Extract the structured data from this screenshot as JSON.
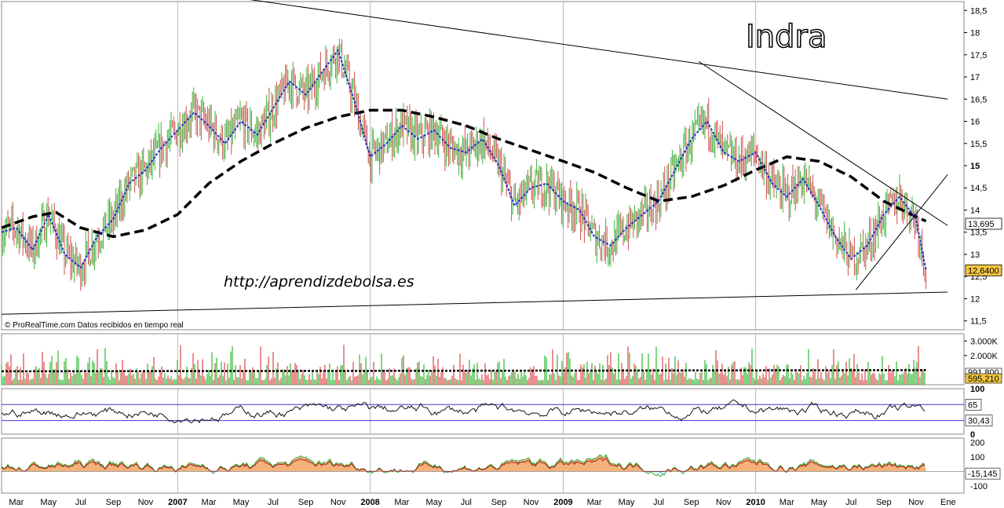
{
  "chart_data": [
    {
      "type": "line",
      "title": "Indra",
      "watermark": "http://aprendizdebolsa.es",
      "credit": "© ProRealTime.com  Datos recibidos en tiempo real",
      "y_axis": {
        "ticks": [
          "18,5",
          "18",
          "17,5",
          "17",
          "16,5",
          "16",
          "15,5",
          "15",
          "14,5",
          "14",
          "13,5",
          "13",
          "12,5",
          "12",
          "11,5"
        ],
        "ylim": [
          11.3,
          18.7
        ]
      },
      "price_boxes": {
        "sma_short": "13,695",
        "last": "12,6400"
      },
      "series": [
        {
          "values": [
            [
              "2006-02-01",
              13.5
            ],
            [
              "2006-03-01",
              13.6
            ],
            [
              "2006-04-01",
              13.1
            ],
            [
              "2006-05-01",
              13.9
            ],
            [
              "2006-06-01",
              13.0
            ],
            [
              "2006-07-01",
              12.7
            ],
            [
              "2006-08-01",
              13.4
            ],
            [
              "2006-09-01",
              13.8
            ],
            [
              "2006-10-01",
              14.6
            ],
            [
              "2006-11-01",
              14.9
            ],
            [
              "2006-12-01",
              15.4
            ],
            [
              "2007-01-01",
              15.8
            ],
            [
              "2007-02-01",
              16.2
            ],
            [
              "2007-03-01",
              15.9
            ],
            [
              "2007-04-01",
              15.5
            ],
            [
              "2007-05-01",
              16.0
            ],
            [
              "2007-06-01",
              15.7
            ],
            [
              "2007-07-01",
              16.3
            ],
            [
              "2007-08-01",
              16.9
            ],
            [
              "2007-09-01",
              16.6
            ],
            [
              "2007-10-01",
              17.1
            ],
            [
              "2007-11-01",
              17.6
            ],
            [
              "2007-12-01",
              16.5
            ],
            [
              "2008-01-01",
              15.2
            ],
            [
              "2008-02-01",
              15.5
            ],
            [
              "2008-03-01",
              15.9
            ],
            [
              "2008-04-01",
              15.6
            ],
            [
              "2008-05-01",
              15.8
            ],
            [
              "2008-06-01",
              15.4
            ],
            [
              "2008-07-01",
              15.3
            ],
            [
              "2008-08-01",
              15.6
            ],
            [
              "2008-09-01",
              15.0
            ],
            [
              "2008-10-01",
              14.1
            ],
            [
              "2008-11-01",
              14.5
            ],
            [
              "2008-12-01",
              14.6
            ],
            [
              "2009-01-01",
              14.2
            ],
            [
              "2009-02-01",
              14.0
            ],
            [
              "2009-03-01",
              13.4
            ],
            [
              "2009-04-01",
              13.2
            ],
            [
              "2009-05-01",
              13.6
            ],
            [
              "2009-06-01",
              13.9
            ],
            [
              "2009-07-01",
              14.2
            ],
            [
              "2009-08-01",
              14.9
            ],
            [
              "2009-09-01",
              15.6
            ],
            [
              "2009-10-01",
              16.0
            ],
            [
              "2009-11-01",
              15.3
            ],
            [
              "2009-12-01",
              15.1
            ],
            [
              "2010-01-01",
              15.3
            ],
            [
              "2010-02-01",
              14.6
            ],
            [
              "2010-03-01",
              14.3
            ],
            [
              "2010-04-01",
              14.7
            ],
            [
              "2010-05-01",
              14.1
            ],
            [
              "2010-06-01",
              13.4
            ],
            [
              "2010-07-01",
              12.9
            ],
            [
              "2010-08-01",
              13.2
            ],
            [
              "2010-09-01",
              13.9
            ],
            [
              "2010-10-01",
              14.3
            ],
            [
              "2010-11-01",
              13.8
            ],
            [
              "2010-11-20",
              12.64
            ]
          ]
        },
        {
          "values": [
            [
              "2006-02-01",
              13.6
            ],
            [
              "2006-04-01",
              13.85
            ],
            [
              "2006-05-15",
              13.95
            ],
            [
              "2006-07-01",
              13.6
            ],
            [
              "2006-09-01",
              13.4
            ],
            [
              "2006-11-01",
              13.55
            ],
            [
              "2007-01-01",
              13.9
            ],
            [
              "2007-03-01",
              14.6
            ],
            [
              "2007-05-01",
              15.1
            ],
            [
              "2007-07-01",
              15.5
            ],
            [
              "2007-09-01",
              15.85
            ],
            [
              "2007-11-01",
              16.1
            ],
            [
              "2008-01-01",
              16.25
            ],
            [
              "2008-03-01",
              16.25
            ],
            [
              "2008-05-01",
              16.1
            ],
            [
              "2008-07-01",
              15.9
            ],
            [
              "2008-09-01",
              15.6
            ],
            [
              "2008-11-01",
              15.35
            ],
            [
              "2009-01-01",
              15.1
            ],
            [
              "2009-03-01",
              14.85
            ],
            [
              "2009-05-01",
              14.5
            ],
            [
              "2009-07-01",
              14.2
            ],
            [
              "2009-09-01",
              14.3
            ],
            [
              "2009-11-01",
              14.55
            ],
            [
              "2010-01-01",
              14.9
            ],
            [
              "2010-03-01",
              15.2
            ],
            [
              "2010-05-01",
              15.1
            ],
            [
              "2010-07-01",
              14.75
            ],
            [
              "2010-09-01",
              14.2
            ],
            [
              "2010-11-01",
              13.85
            ],
            [
              "2010-11-20",
              13.75
            ]
          ]
        }
      ],
      "trendlines": [
        {
          "from": [
            "2006-02-01",
            11.65
          ],
          "to": [
            "2010-12-31",
            12.15
          ]
        },
        {
          "from": [
            "2007-04-15",
            18.8
          ],
          "to": [
            "2010-12-31",
            16.5
          ]
        },
        {
          "from": [
            "2009-09-15",
            17.35
          ],
          "to": [
            "2010-12-31",
            13.65
          ]
        },
        {
          "from": [
            "2010-07-10",
            12.2
          ],
          "to": [
            "2010-12-31",
            14.8
          ]
        }
      ]
    },
    {
      "type": "bar",
      "y_axis": {
        "ticks": [
          "3.000K",
          "2.000K"
        ]
      },
      "value_boxes": {
        "average": "991,800",
        "last": "595,210"
      }
    },
    {
      "type": "line",
      "y_axis": {
        "ticks": [
          "100",
          "0"
        ],
        "ylim": [
          0,
          100
        ]
      },
      "levels": [
        65,
        30
      ],
      "value_boxes": {
        "level": "65",
        "last": "30,43"
      }
    },
    {
      "type": "area",
      "y_axis": {
        "ticks": [
          "200",
          "100",
          "-100"
        ],
        "ylim": [
          -150,
          230
        ]
      },
      "value_boxes": {
        "last": "-15,145"
      }
    }
  ],
  "x_axis": {
    "labels": [
      {
        "date": "2006-03-01",
        "label": "Mar"
      },
      {
        "date": "2006-05-01",
        "label": "May"
      },
      {
        "date": "2006-07-01",
        "label": "Jul"
      },
      {
        "date": "2006-09-01",
        "label": "Sep"
      },
      {
        "date": "2006-11-01",
        "label": "Nov"
      },
      {
        "date": "2007-01-01",
        "label": "2007",
        "bold": true
      },
      {
        "date": "2007-03-01",
        "label": "Mar"
      },
      {
        "date": "2007-05-01",
        "label": "May"
      },
      {
        "date": "2007-07-01",
        "label": "Jul"
      },
      {
        "date": "2007-09-01",
        "label": "Sep"
      },
      {
        "date": "2007-11-01",
        "label": "Nov"
      },
      {
        "date": "2008-01-01",
        "label": "2008",
        "bold": true
      },
      {
        "date": "2008-03-01",
        "label": "Mar"
      },
      {
        "date": "2008-05-01",
        "label": "May"
      },
      {
        "date": "2008-07-01",
        "label": "Jul"
      },
      {
        "date": "2008-09-01",
        "label": "Sep"
      },
      {
        "date": "2008-11-01",
        "label": "Nov"
      },
      {
        "date": "2009-01-01",
        "label": "2009",
        "bold": true
      },
      {
        "date": "2009-03-01",
        "label": "Mar"
      },
      {
        "date": "2009-05-01",
        "label": "May"
      },
      {
        "date": "2009-07-01",
        "label": "Jul"
      },
      {
        "date": "2009-09-01",
        "label": "Sep"
      },
      {
        "date": "2009-11-01",
        "label": "Nov"
      },
      {
        "date": "2010-01-01",
        "label": "2010",
        "bold": true
      },
      {
        "date": "2010-03-01",
        "label": "Mar"
      },
      {
        "date": "2010-05-01",
        "label": "May"
      },
      {
        "date": "2010-07-01",
        "label": "Jul"
      },
      {
        "date": "2010-09-01",
        "label": "Sep"
      },
      {
        "date": "2010-11-01",
        "label": "Nov"
      },
      {
        "date": "2011-01-01",
        "label": "Ene"
      }
    ]
  },
  "colors": {
    "price_up": "#3cb43c",
    "price_down": "#d05050",
    "sma_short": "#1f2fd6",
    "sma_long": "#000000",
    "volume_up": "#4cc24c",
    "volume_down": "#e06060",
    "last_box": "#f5c842",
    "momentum_fill": "#f4b27a",
    "momentum_neg": "#2ad0e0",
    "panel_bg": "#eef3fb"
  }
}
